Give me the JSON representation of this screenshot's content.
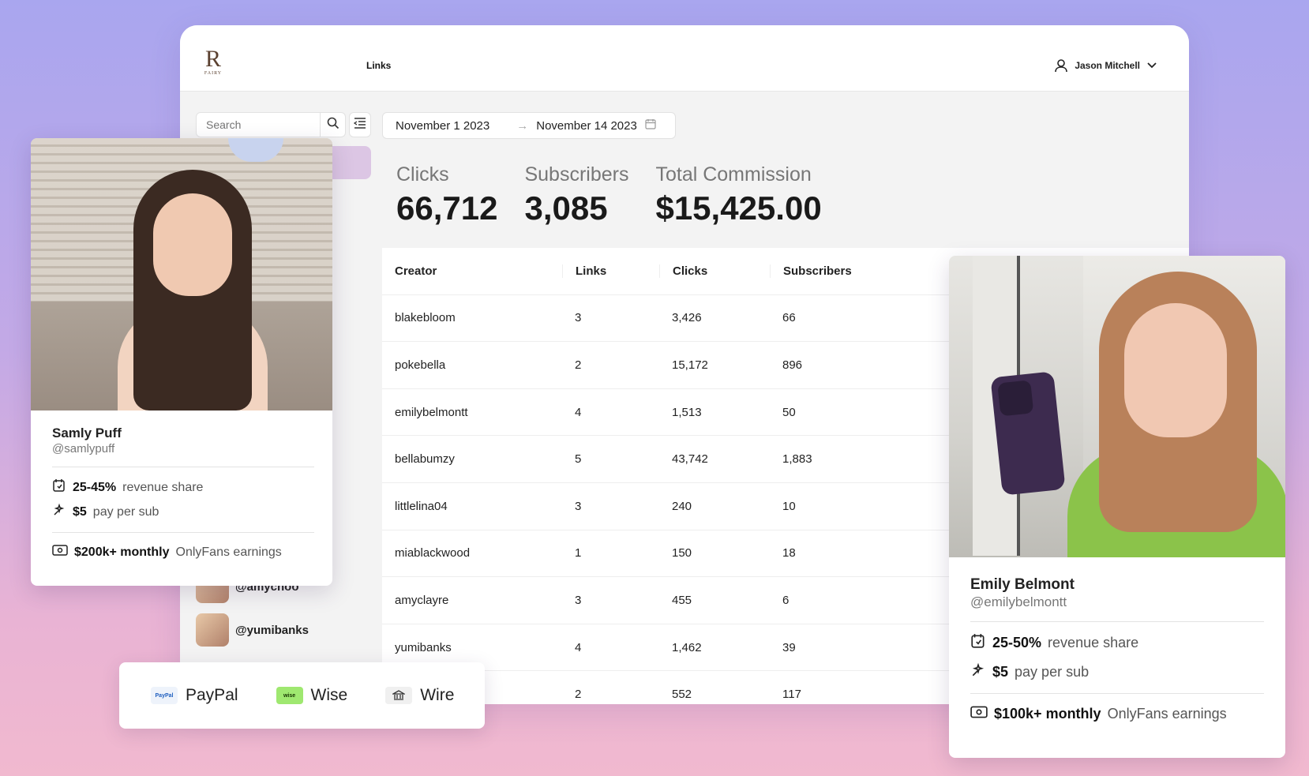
{
  "app": {
    "logo_mark": "R",
    "logo_word": "FAIRY",
    "nav_links": "Links",
    "user_name": "Jason Mitchell"
  },
  "search": {
    "placeholder": "Search"
  },
  "date_range": {
    "start": "November 1 2023",
    "arrow": "→",
    "end": "November 14 2023"
  },
  "stats": [
    {
      "label": "Clicks",
      "value": "66,712"
    },
    {
      "label": "Subscribers",
      "value": "3,085"
    },
    {
      "label": "Total Commission",
      "value": "$15,425.00"
    }
  ],
  "table": {
    "headers": [
      "Creator",
      "Links",
      "Clicks",
      "Subscribers"
    ],
    "rows": [
      [
        "blakebloom",
        "3",
        "3,426",
        "66"
      ],
      [
        "pokebella",
        "2",
        "15,172",
        "896"
      ],
      [
        "emilybelmontt",
        "4",
        "1,513",
        "50"
      ],
      [
        "bellabumzy",
        "5",
        "43,742",
        "1,883"
      ],
      [
        "littlelina04",
        "3",
        "240",
        "10"
      ],
      [
        "miablackwood",
        "1",
        "150",
        "18"
      ],
      [
        "amyclayre",
        "3",
        "455",
        "6"
      ],
      [
        "yumibanks",
        "4",
        "1,462",
        "39"
      ],
      [
        "",
        "2",
        "552",
        "117"
      ]
    ]
  },
  "sidebar": {
    "creators": [
      "@amychoo",
      "@yumibanks"
    ]
  },
  "card1": {
    "name": "Samly Puff",
    "handle": "@samlypuff",
    "share_bold": "25-45%",
    "share_text": "revenue share",
    "pay_bold": "$5",
    "pay_text": "pay per sub",
    "earn_bold": "$200k+ monthly",
    "earn_text": "OnlyFans earnings"
  },
  "card2": {
    "name": "Emily Belmont",
    "handle": "@emilybelmontt",
    "share_bold": "25-50%",
    "share_text": "revenue share",
    "pay_bold": "$5",
    "pay_text": "pay per sub",
    "earn_bold": "$100k+ monthly",
    "earn_text": "OnlyFans earnings"
  },
  "payments": [
    {
      "icon": "PayPal",
      "label": "PayPal"
    },
    {
      "icon": "wise",
      "label": "Wise"
    },
    {
      "icon": "bank-icon",
      "label": "Wire"
    }
  ]
}
